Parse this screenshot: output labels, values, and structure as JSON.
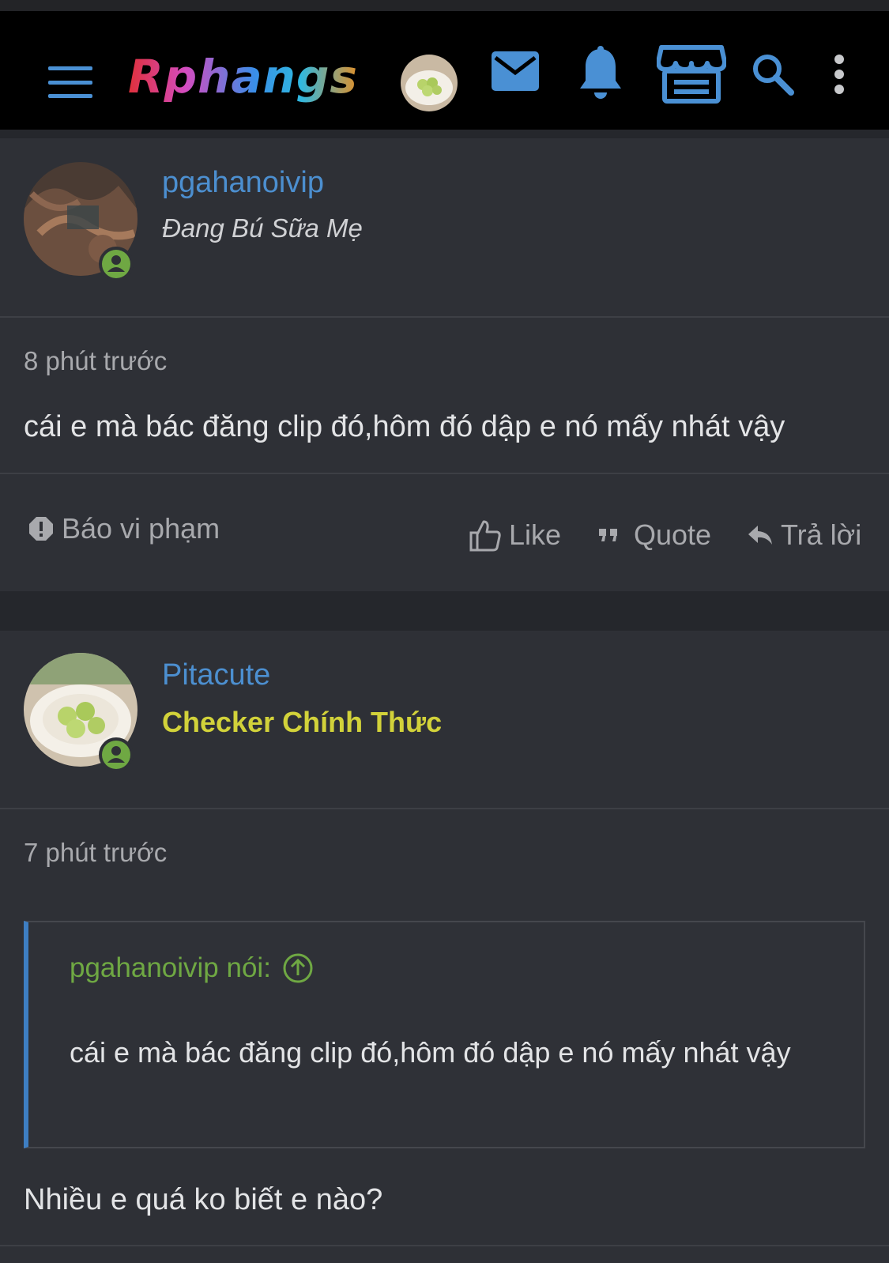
{
  "header": {
    "logo_text": "Rphangs",
    "icons": [
      "menu-icon",
      "avatar",
      "mail-icon",
      "bell-icon",
      "store-icon",
      "search-icon",
      "more-vertical-icon"
    ],
    "accent_color": "#4a90d4"
  },
  "posts": [
    {
      "username": "pgahanoivip",
      "user_title": "Đang Bú Sữa Mẹ",
      "time": "8 phút trước",
      "message": "cái e mà bác đăng clip đó,hôm đó dập e nó mấy nhát vậy",
      "actions": {
        "report": "Báo vi phạm",
        "like": "Like",
        "quote": "Quote",
        "reply": "Trả lời"
      }
    },
    {
      "username": "Pitacute",
      "user_title": "Checker Chính Thức",
      "time": "7 phút trước",
      "quote": {
        "author": "pgahanoivip nói:",
        "text": "cái e mà bác đăng clip đó,hôm đó dập e nó mấy nhát vậy"
      },
      "message": "Nhiều e quá ko biết e nào?"
    }
  ],
  "colors": {
    "username": "#4c8fd0",
    "checker_title": "#d2d23a",
    "online": "#6fa843",
    "quote_bar": "#3e7ec2"
  }
}
